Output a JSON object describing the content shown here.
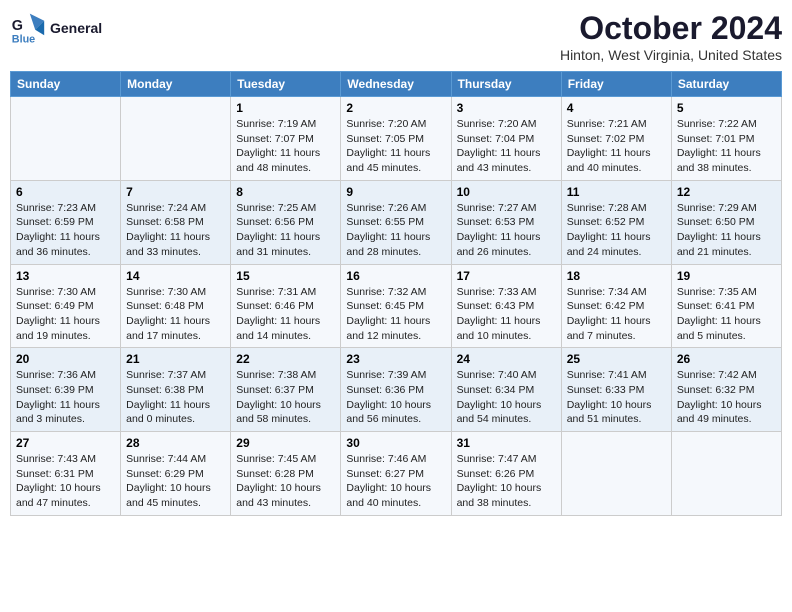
{
  "logo": {
    "line1": "General",
    "line2": "Blue"
  },
  "title": "October 2024",
  "location": "Hinton, West Virginia, United States",
  "weekdays": [
    "Sunday",
    "Monday",
    "Tuesday",
    "Wednesday",
    "Thursday",
    "Friday",
    "Saturday"
  ],
  "weeks": [
    [
      {
        "day": "",
        "data": ""
      },
      {
        "day": "",
        "data": ""
      },
      {
        "day": "1",
        "data": "Sunrise: 7:19 AM\nSunset: 7:07 PM\nDaylight: 11 hours and 48 minutes."
      },
      {
        "day": "2",
        "data": "Sunrise: 7:20 AM\nSunset: 7:05 PM\nDaylight: 11 hours and 45 minutes."
      },
      {
        "day": "3",
        "data": "Sunrise: 7:20 AM\nSunset: 7:04 PM\nDaylight: 11 hours and 43 minutes."
      },
      {
        "day": "4",
        "data": "Sunrise: 7:21 AM\nSunset: 7:02 PM\nDaylight: 11 hours and 40 minutes."
      },
      {
        "day": "5",
        "data": "Sunrise: 7:22 AM\nSunset: 7:01 PM\nDaylight: 11 hours and 38 minutes."
      }
    ],
    [
      {
        "day": "6",
        "data": "Sunrise: 7:23 AM\nSunset: 6:59 PM\nDaylight: 11 hours and 36 minutes."
      },
      {
        "day": "7",
        "data": "Sunrise: 7:24 AM\nSunset: 6:58 PM\nDaylight: 11 hours and 33 minutes."
      },
      {
        "day": "8",
        "data": "Sunrise: 7:25 AM\nSunset: 6:56 PM\nDaylight: 11 hours and 31 minutes."
      },
      {
        "day": "9",
        "data": "Sunrise: 7:26 AM\nSunset: 6:55 PM\nDaylight: 11 hours and 28 minutes."
      },
      {
        "day": "10",
        "data": "Sunrise: 7:27 AM\nSunset: 6:53 PM\nDaylight: 11 hours and 26 minutes."
      },
      {
        "day": "11",
        "data": "Sunrise: 7:28 AM\nSunset: 6:52 PM\nDaylight: 11 hours and 24 minutes."
      },
      {
        "day": "12",
        "data": "Sunrise: 7:29 AM\nSunset: 6:50 PM\nDaylight: 11 hours and 21 minutes."
      }
    ],
    [
      {
        "day": "13",
        "data": "Sunrise: 7:30 AM\nSunset: 6:49 PM\nDaylight: 11 hours and 19 minutes."
      },
      {
        "day": "14",
        "data": "Sunrise: 7:30 AM\nSunset: 6:48 PM\nDaylight: 11 hours and 17 minutes."
      },
      {
        "day": "15",
        "data": "Sunrise: 7:31 AM\nSunset: 6:46 PM\nDaylight: 11 hours and 14 minutes."
      },
      {
        "day": "16",
        "data": "Sunrise: 7:32 AM\nSunset: 6:45 PM\nDaylight: 11 hours and 12 minutes."
      },
      {
        "day": "17",
        "data": "Sunrise: 7:33 AM\nSunset: 6:43 PM\nDaylight: 11 hours and 10 minutes."
      },
      {
        "day": "18",
        "data": "Sunrise: 7:34 AM\nSunset: 6:42 PM\nDaylight: 11 hours and 7 minutes."
      },
      {
        "day": "19",
        "data": "Sunrise: 7:35 AM\nSunset: 6:41 PM\nDaylight: 11 hours and 5 minutes."
      }
    ],
    [
      {
        "day": "20",
        "data": "Sunrise: 7:36 AM\nSunset: 6:39 PM\nDaylight: 11 hours and 3 minutes."
      },
      {
        "day": "21",
        "data": "Sunrise: 7:37 AM\nSunset: 6:38 PM\nDaylight: 11 hours and 0 minutes."
      },
      {
        "day": "22",
        "data": "Sunrise: 7:38 AM\nSunset: 6:37 PM\nDaylight: 10 hours and 58 minutes."
      },
      {
        "day": "23",
        "data": "Sunrise: 7:39 AM\nSunset: 6:36 PM\nDaylight: 10 hours and 56 minutes."
      },
      {
        "day": "24",
        "data": "Sunrise: 7:40 AM\nSunset: 6:34 PM\nDaylight: 10 hours and 54 minutes."
      },
      {
        "day": "25",
        "data": "Sunrise: 7:41 AM\nSunset: 6:33 PM\nDaylight: 10 hours and 51 minutes."
      },
      {
        "day": "26",
        "data": "Sunrise: 7:42 AM\nSunset: 6:32 PM\nDaylight: 10 hours and 49 minutes."
      }
    ],
    [
      {
        "day": "27",
        "data": "Sunrise: 7:43 AM\nSunset: 6:31 PM\nDaylight: 10 hours and 47 minutes."
      },
      {
        "day": "28",
        "data": "Sunrise: 7:44 AM\nSunset: 6:29 PM\nDaylight: 10 hours and 45 minutes."
      },
      {
        "day": "29",
        "data": "Sunrise: 7:45 AM\nSunset: 6:28 PM\nDaylight: 10 hours and 43 minutes."
      },
      {
        "day": "30",
        "data": "Sunrise: 7:46 AM\nSunset: 6:27 PM\nDaylight: 10 hours and 40 minutes."
      },
      {
        "day": "31",
        "data": "Sunrise: 7:47 AM\nSunset: 6:26 PM\nDaylight: 10 hours and 38 minutes."
      },
      {
        "day": "",
        "data": ""
      },
      {
        "day": "",
        "data": ""
      }
    ]
  ]
}
